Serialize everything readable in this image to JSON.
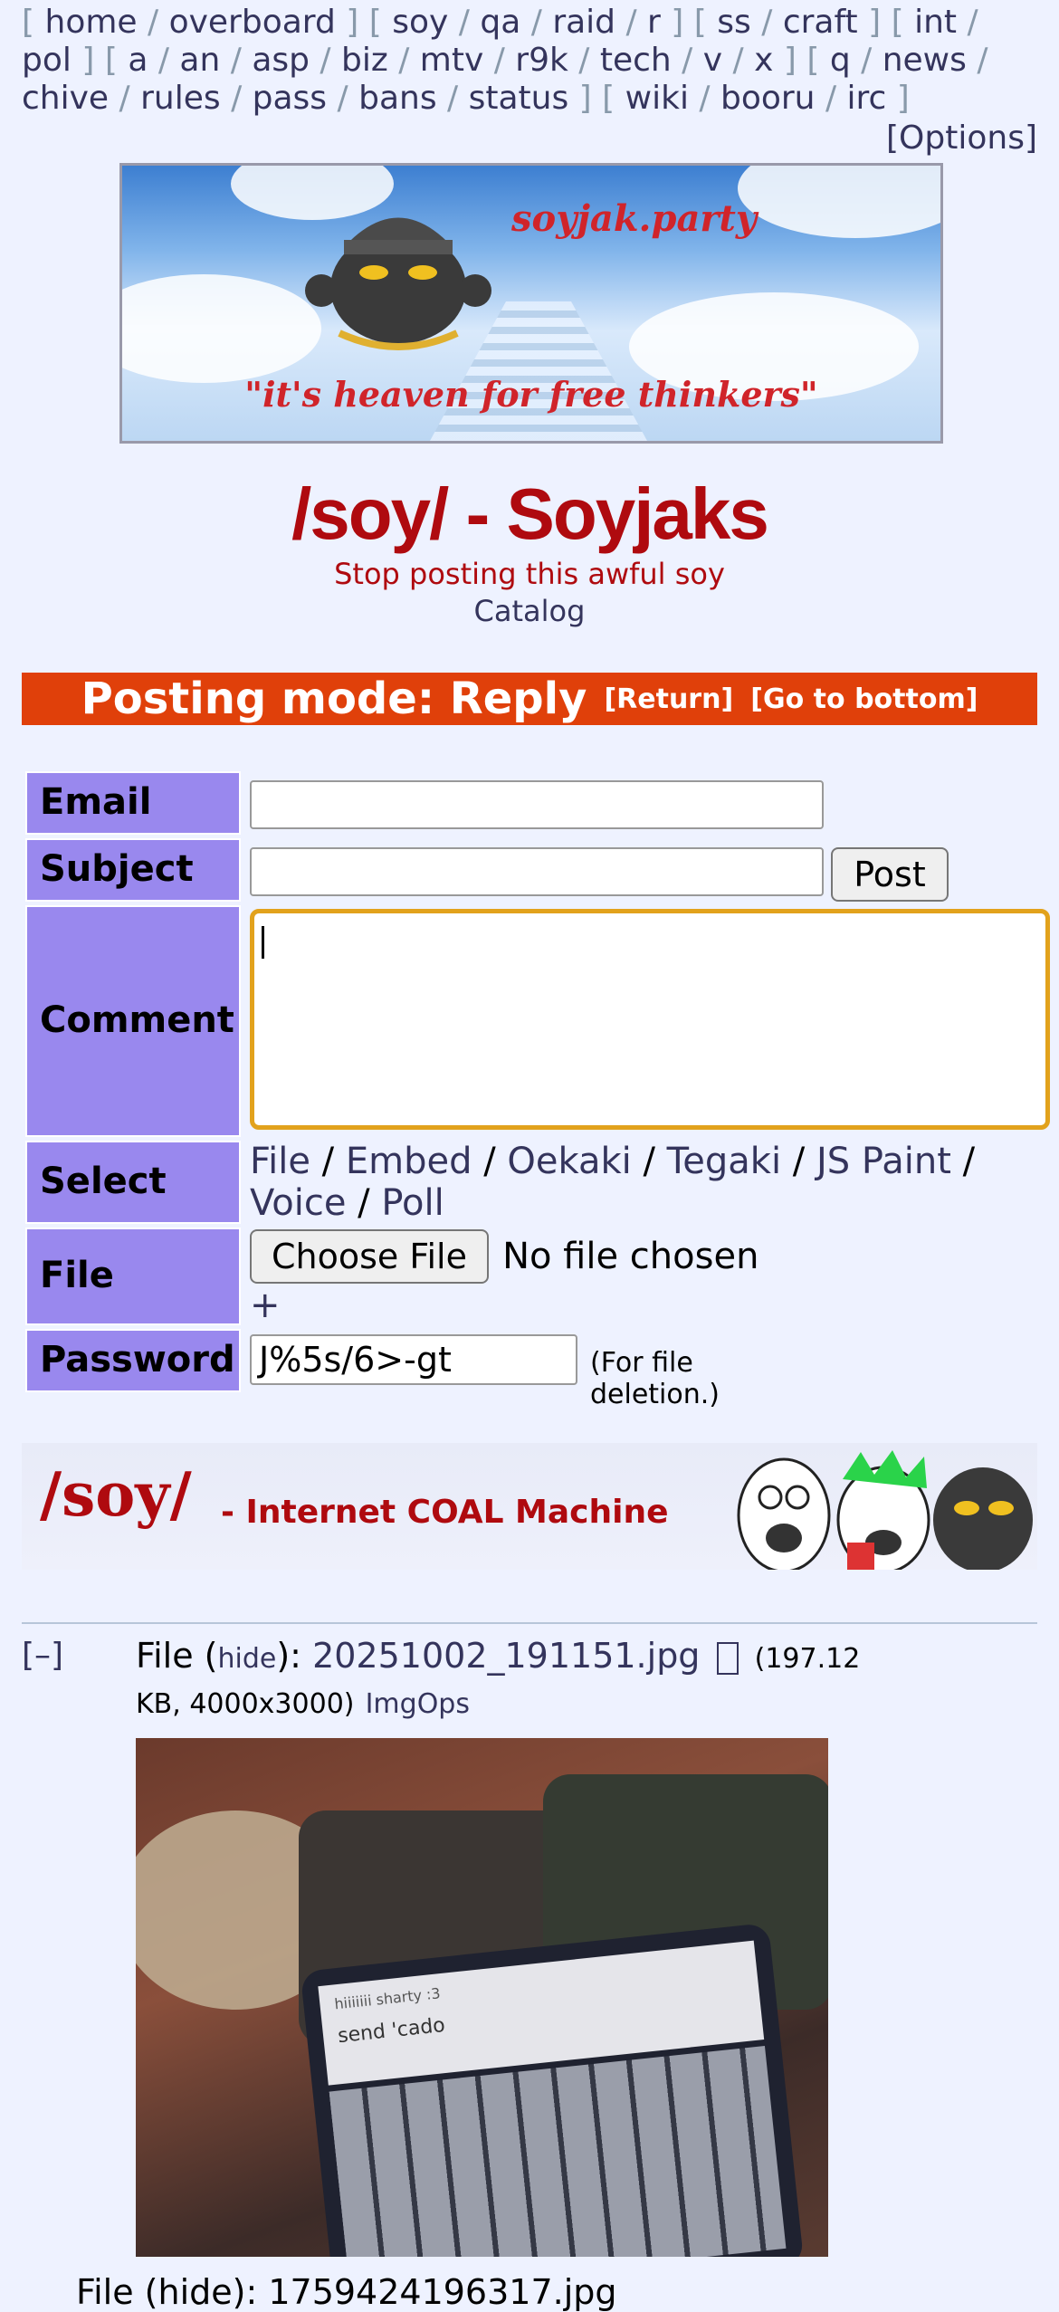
{
  "nav": {
    "groups": [
      [
        "home",
        "overboard"
      ],
      [
        "soy",
        "qa",
        "raid",
        "r"
      ],
      [
        "ss",
        "craft"
      ],
      [
        "int",
        "pol"
      ],
      [
        "a",
        "an",
        "asp",
        "biz",
        "mtv",
        "r9k",
        "tech",
        "v",
        "x"
      ],
      [
        "q",
        "news",
        "chive",
        "rules",
        "pass",
        "bans",
        "status"
      ],
      [
        "wiki",
        "booru",
        "irc"
      ]
    ],
    "options": "[Options]"
  },
  "banner": {
    "site": "soyjak.party",
    "motto": "\"it's heaven for free thinkers\""
  },
  "board": {
    "title": "/soy/ - Soyjaks",
    "subtitle": "Stop posting this awful soy",
    "catalog": "Catalog"
  },
  "posting": {
    "mode": "Posting mode: Reply",
    "return": "[Return]",
    "bottom": "[Go to bottom]"
  },
  "form": {
    "email_label": "Email",
    "subject_label": "Subject",
    "post_button": "Post",
    "comment_label": "Comment",
    "select_label": "Select",
    "select_options": [
      "File",
      "Embed",
      "Oekaki",
      "Tegaki",
      "JS Paint",
      "Voice",
      "Poll"
    ],
    "file_label": "File",
    "choose_file": "Choose File",
    "no_file": "No file chosen",
    "add_more": "+",
    "password_label": "Password",
    "password_value": "J%5s/6>-gt",
    "password_note": "(For file deletion.)"
  },
  "ad": {
    "big": "/soy/",
    "rest": "- Internet COAL Machine"
  },
  "post": {
    "toggle": "[–]",
    "file_prefix": "File (",
    "hide": "hide",
    "file_mid": "): ",
    "filename": "20251002_191151.jpg",
    "meta_a": "(197.12",
    "meta_b": "KB, 4000x3000)",
    "imgops": "ImgOps",
    "screen_line1": "hiiiiiii sharty :3",
    "screen_line2": "send 'cado",
    "next_file": "File (hide): 1759424196317.jpg"
  }
}
